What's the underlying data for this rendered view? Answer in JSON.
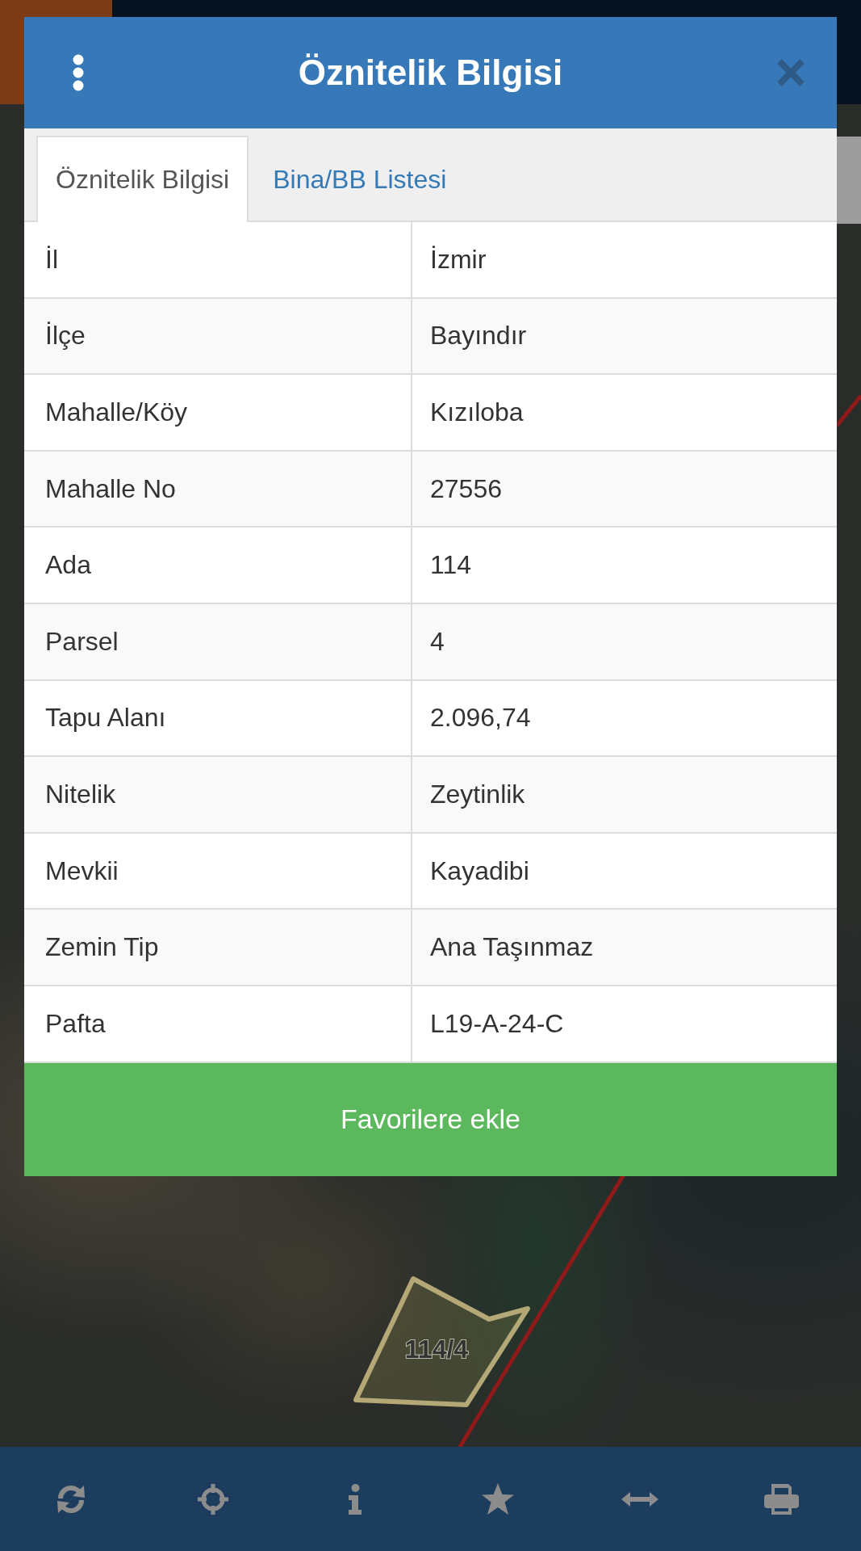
{
  "dialog": {
    "title": "Öznitelik Bilgisi",
    "tabs": [
      {
        "label": "Öznitelik Bilgisi",
        "selected": true
      },
      {
        "label": "Bina/BB Listesi",
        "selected": false
      }
    ],
    "rows": [
      {
        "label": "İl",
        "value": "İzmir"
      },
      {
        "label": "İlçe",
        "value": "Bayındır"
      },
      {
        "label": "Mahalle/Köy",
        "value": "Kızıloba"
      },
      {
        "label": "Mahalle No",
        "value": "27556"
      },
      {
        "label": "Ada",
        "value": "114"
      },
      {
        "label": "Parsel",
        "value": "4"
      },
      {
        "label": "Tapu Alanı",
        "value": "2.096,74"
      },
      {
        "label": "Nitelik",
        "value": "Zeytinlik"
      },
      {
        "label": "Mevkii",
        "value": "Kayadibi"
      },
      {
        "label": "Zemin Tip",
        "value": "Ana Taşınmaz"
      },
      {
        "label": "Pafta",
        "value": "L19-A-24-C"
      }
    ],
    "button": "Favorilere ekle"
  },
  "map": {
    "parcel_label": "114/4"
  }
}
